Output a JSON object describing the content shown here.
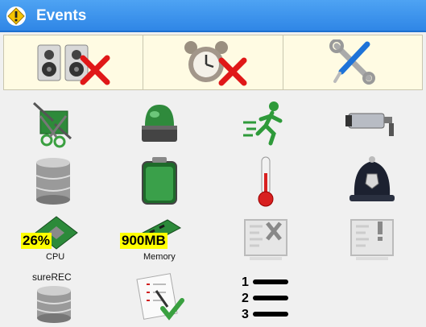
{
  "window": {
    "title": "Events",
    "icon": "warning-icon"
  },
  "toolbar": {
    "items": [
      {
        "name": "speakers-off-button",
        "icon": "speakers-mute-icon"
      },
      {
        "name": "alarm-off-button",
        "icon": "alarm-clock-off-icon"
      },
      {
        "name": "settings-button",
        "icon": "tools-icon"
      }
    ]
  },
  "events": [
    {
      "icon": "cut-wire-icon"
    },
    {
      "icon": "green-beacon-icon"
    },
    {
      "icon": "running-man-exit-icon"
    },
    {
      "icon": "security-camera-icon"
    },
    {
      "icon": "database-icon"
    },
    {
      "icon": "battery-icon"
    },
    {
      "icon": "thermometer-icon"
    },
    {
      "icon": "police-helmet-icon"
    },
    {
      "icon": "cpu-chip-icon",
      "value": "26%",
      "label": "CPU"
    },
    {
      "icon": "memory-module-icon",
      "value": "900MB",
      "label": "Memory"
    },
    {
      "icon": "disabled-panel-icon"
    },
    {
      "icon": "alert-panel-icon"
    },
    {
      "icon": "surerec-database-icon",
      "label": "sureREC"
    },
    {
      "icon": "checklist-icon"
    },
    {
      "icon": "numbered-list-icon"
    }
  ],
  "colors": {
    "titlebar": "#3a91ea",
    "toolbar": "#fffbe3",
    "highlight": "#ffff00",
    "red_x": "#e01818"
  }
}
